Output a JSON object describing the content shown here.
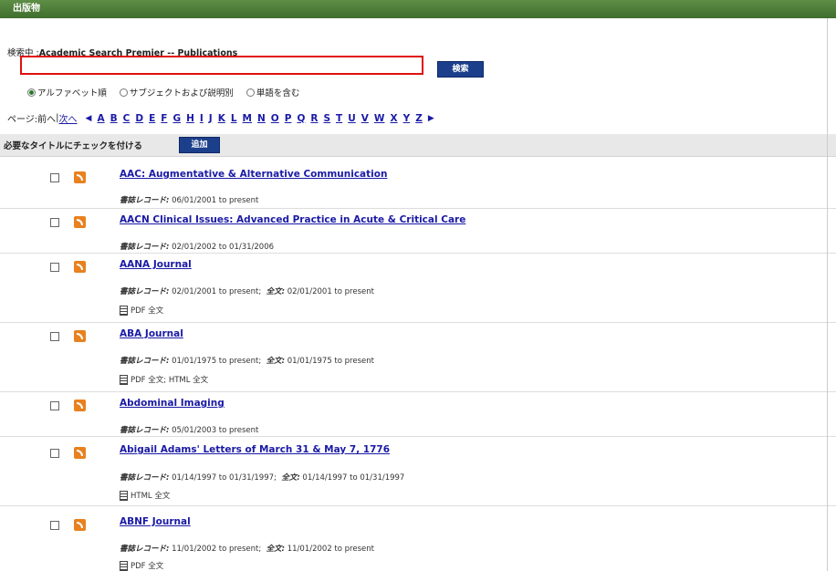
{
  "panel": {
    "title": "出版物"
  },
  "search": {
    "searching_label": "検索中",
    "database": "Academic Search Premier -- Publications",
    "input_value": "",
    "button_label": "検索"
  },
  "radio_options": [
    {
      "label": "アルファベット順",
      "selected": true
    },
    {
      "label": "サブジェクトおよび説明別",
      "selected": false
    },
    {
      "label": "単語を含む",
      "selected": false
    }
  ],
  "pager": {
    "label": "ページ:",
    "prev": "前へ",
    "separator": "|",
    "next": "次へ",
    "letters": [
      "A",
      "B",
      "C",
      "D",
      "E",
      "F",
      "G",
      "H",
      "I",
      "J",
      "K",
      "L",
      "M",
      "N",
      "O",
      "P",
      "Q",
      "R",
      "S",
      "T",
      "U",
      "V",
      "W",
      "X",
      "Y",
      "Z"
    ]
  },
  "addbar": {
    "label": "必要なタイトルにチェックを付ける",
    "button_label": "追加"
  },
  "colors": {
    "accent": "#1c3f8c",
    "header": "#4a7a36",
    "link": "#1a1aa6",
    "highlight": "#e01010",
    "rss": "#e8811e"
  },
  "publications": [
    {
      "title": "AAC: Augmentative & Alternative Communication",
      "meta": "06/01/2001 to present",
      "fulltext": ""
    },
    {
      "title": "AACN Clinical Issues: Advanced Practice in Acute & Critical Care",
      "meta": "02/01/2002 to 01/31/2006",
      "fulltext": ""
    },
    {
      "title": "AANA Journal",
      "meta": "02/01/2001 to present;",
      "fulltext_dates": "02/01/2001 to present",
      "links": "PDF 全文"
    },
    {
      "title": "ABA Journal",
      "meta": "01/01/1975 to present;",
      "fulltext_dates": "01/01/1975 to present",
      "links": "PDF 全文; HTML 全文"
    },
    {
      "title": "Abdominal Imaging",
      "meta": "05/01/2003 to present",
      "fulltext": ""
    },
    {
      "title": "Abigail Adams' Letters of March 31 & May 7, 1776",
      "meta": "01/14/1997 to 01/31/1997;",
      "fulltext_dates": "01/14/1997 to 01/31/1997",
      "links": "HTML 全文"
    },
    {
      "title": "ABNF Journal",
      "meta": "11/01/2002 to present;",
      "fulltext_dates": "11/01/2002 to present",
      "links": "PDF 全文"
    }
  ],
  "labels": {
    "record": "書誌レコード:",
    "fulltext": "全文:"
  }
}
